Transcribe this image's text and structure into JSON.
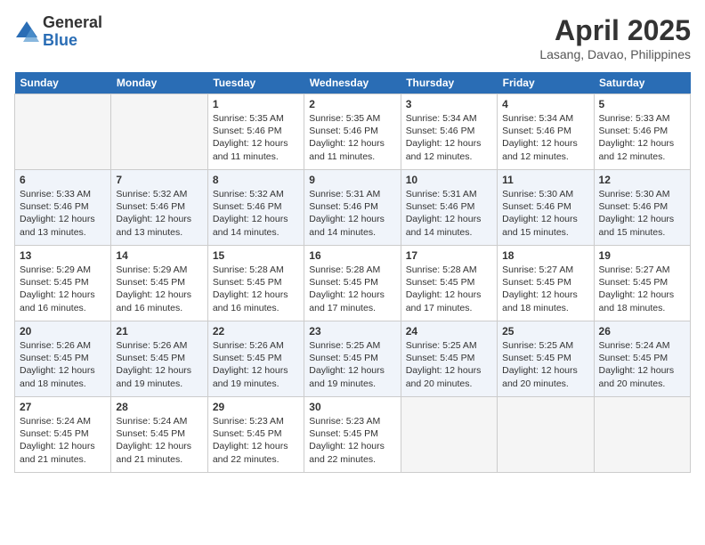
{
  "header": {
    "logo_general": "General",
    "logo_blue": "Blue",
    "month_title": "April 2025",
    "location": "Lasang, Davao, Philippines"
  },
  "days_of_week": [
    "Sunday",
    "Monday",
    "Tuesday",
    "Wednesday",
    "Thursday",
    "Friday",
    "Saturday"
  ],
  "weeks": [
    [
      {
        "day": "",
        "info": ""
      },
      {
        "day": "",
        "info": ""
      },
      {
        "day": "1",
        "sunrise": "5:35 AM",
        "sunset": "5:46 PM",
        "daylight": "12 hours and 11 minutes."
      },
      {
        "day": "2",
        "sunrise": "5:35 AM",
        "sunset": "5:46 PM",
        "daylight": "12 hours and 11 minutes."
      },
      {
        "day": "3",
        "sunrise": "5:34 AM",
        "sunset": "5:46 PM",
        "daylight": "12 hours and 12 minutes."
      },
      {
        "day": "4",
        "sunrise": "5:34 AM",
        "sunset": "5:46 PM",
        "daylight": "12 hours and 12 minutes."
      },
      {
        "day": "5",
        "sunrise": "5:33 AM",
        "sunset": "5:46 PM",
        "daylight": "12 hours and 12 minutes."
      }
    ],
    [
      {
        "day": "6",
        "sunrise": "5:33 AM",
        "sunset": "5:46 PM",
        "daylight": "12 hours and 13 minutes."
      },
      {
        "day": "7",
        "sunrise": "5:32 AM",
        "sunset": "5:46 PM",
        "daylight": "12 hours and 13 minutes."
      },
      {
        "day": "8",
        "sunrise": "5:32 AM",
        "sunset": "5:46 PM",
        "daylight": "12 hours and 14 minutes."
      },
      {
        "day": "9",
        "sunrise": "5:31 AM",
        "sunset": "5:46 PM",
        "daylight": "12 hours and 14 minutes."
      },
      {
        "day": "10",
        "sunrise": "5:31 AM",
        "sunset": "5:46 PM",
        "daylight": "12 hours and 14 minutes."
      },
      {
        "day": "11",
        "sunrise": "5:30 AM",
        "sunset": "5:46 PM",
        "daylight": "12 hours and 15 minutes."
      },
      {
        "day": "12",
        "sunrise": "5:30 AM",
        "sunset": "5:46 PM",
        "daylight": "12 hours and 15 minutes."
      }
    ],
    [
      {
        "day": "13",
        "sunrise": "5:29 AM",
        "sunset": "5:45 PM",
        "daylight": "12 hours and 16 minutes."
      },
      {
        "day": "14",
        "sunrise": "5:29 AM",
        "sunset": "5:45 PM",
        "daylight": "12 hours and 16 minutes."
      },
      {
        "day": "15",
        "sunrise": "5:28 AM",
        "sunset": "5:45 PM",
        "daylight": "12 hours and 16 minutes."
      },
      {
        "day": "16",
        "sunrise": "5:28 AM",
        "sunset": "5:45 PM",
        "daylight": "12 hours and 17 minutes."
      },
      {
        "day": "17",
        "sunrise": "5:28 AM",
        "sunset": "5:45 PM",
        "daylight": "12 hours and 17 minutes."
      },
      {
        "day": "18",
        "sunrise": "5:27 AM",
        "sunset": "5:45 PM",
        "daylight": "12 hours and 18 minutes."
      },
      {
        "day": "19",
        "sunrise": "5:27 AM",
        "sunset": "5:45 PM",
        "daylight": "12 hours and 18 minutes."
      }
    ],
    [
      {
        "day": "20",
        "sunrise": "5:26 AM",
        "sunset": "5:45 PM",
        "daylight": "12 hours and 18 minutes."
      },
      {
        "day": "21",
        "sunrise": "5:26 AM",
        "sunset": "5:45 PM",
        "daylight": "12 hours and 19 minutes."
      },
      {
        "day": "22",
        "sunrise": "5:26 AM",
        "sunset": "5:45 PM",
        "daylight": "12 hours and 19 minutes."
      },
      {
        "day": "23",
        "sunrise": "5:25 AM",
        "sunset": "5:45 PM",
        "daylight": "12 hours and 19 minutes."
      },
      {
        "day": "24",
        "sunrise": "5:25 AM",
        "sunset": "5:45 PM",
        "daylight": "12 hours and 20 minutes."
      },
      {
        "day": "25",
        "sunrise": "5:25 AM",
        "sunset": "5:45 PM",
        "daylight": "12 hours and 20 minutes."
      },
      {
        "day": "26",
        "sunrise": "5:24 AM",
        "sunset": "5:45 PM",
        "daylight": "12 hours and 20 minutes."
      }
    ],
    [
      {
        "day": "27",
        "sunrise": "5:24 AM",
        "sunset": "5:45 PM",
        "daylight": "12 hours and 21 minutes."
      },
      {
        "day": "28",
        "sunrise": "5:24 AM",
        "sunset": "5:45 PM",
        "daylight": "12 hours and 21 minutes."
      },
      {
        "day": "29",
        "sunrise": "5:23 AM",
        "sunset": "5:45 PM",
        "daylight": "12 hours and 22 minutes."
      },
      {
        "day": "30",
        "sunrise": "5:23 AM",
        "sunset": "5:45 PM",
        "daylight": "12 hours and 22 minutes."
      },
      {
        "day": "",
        "info": ""
      },
      {
        "day": "",
        "info": ""
      },
      {
        "day": "",
        "info": ""
      }
    ]
  ],
  "labels": {
    "sunrise_prefix": "Sunrise: ",
    "sunset_prefix": "Sunset: ",
    "daylight_prefix": "Daylight: "
  }
}
